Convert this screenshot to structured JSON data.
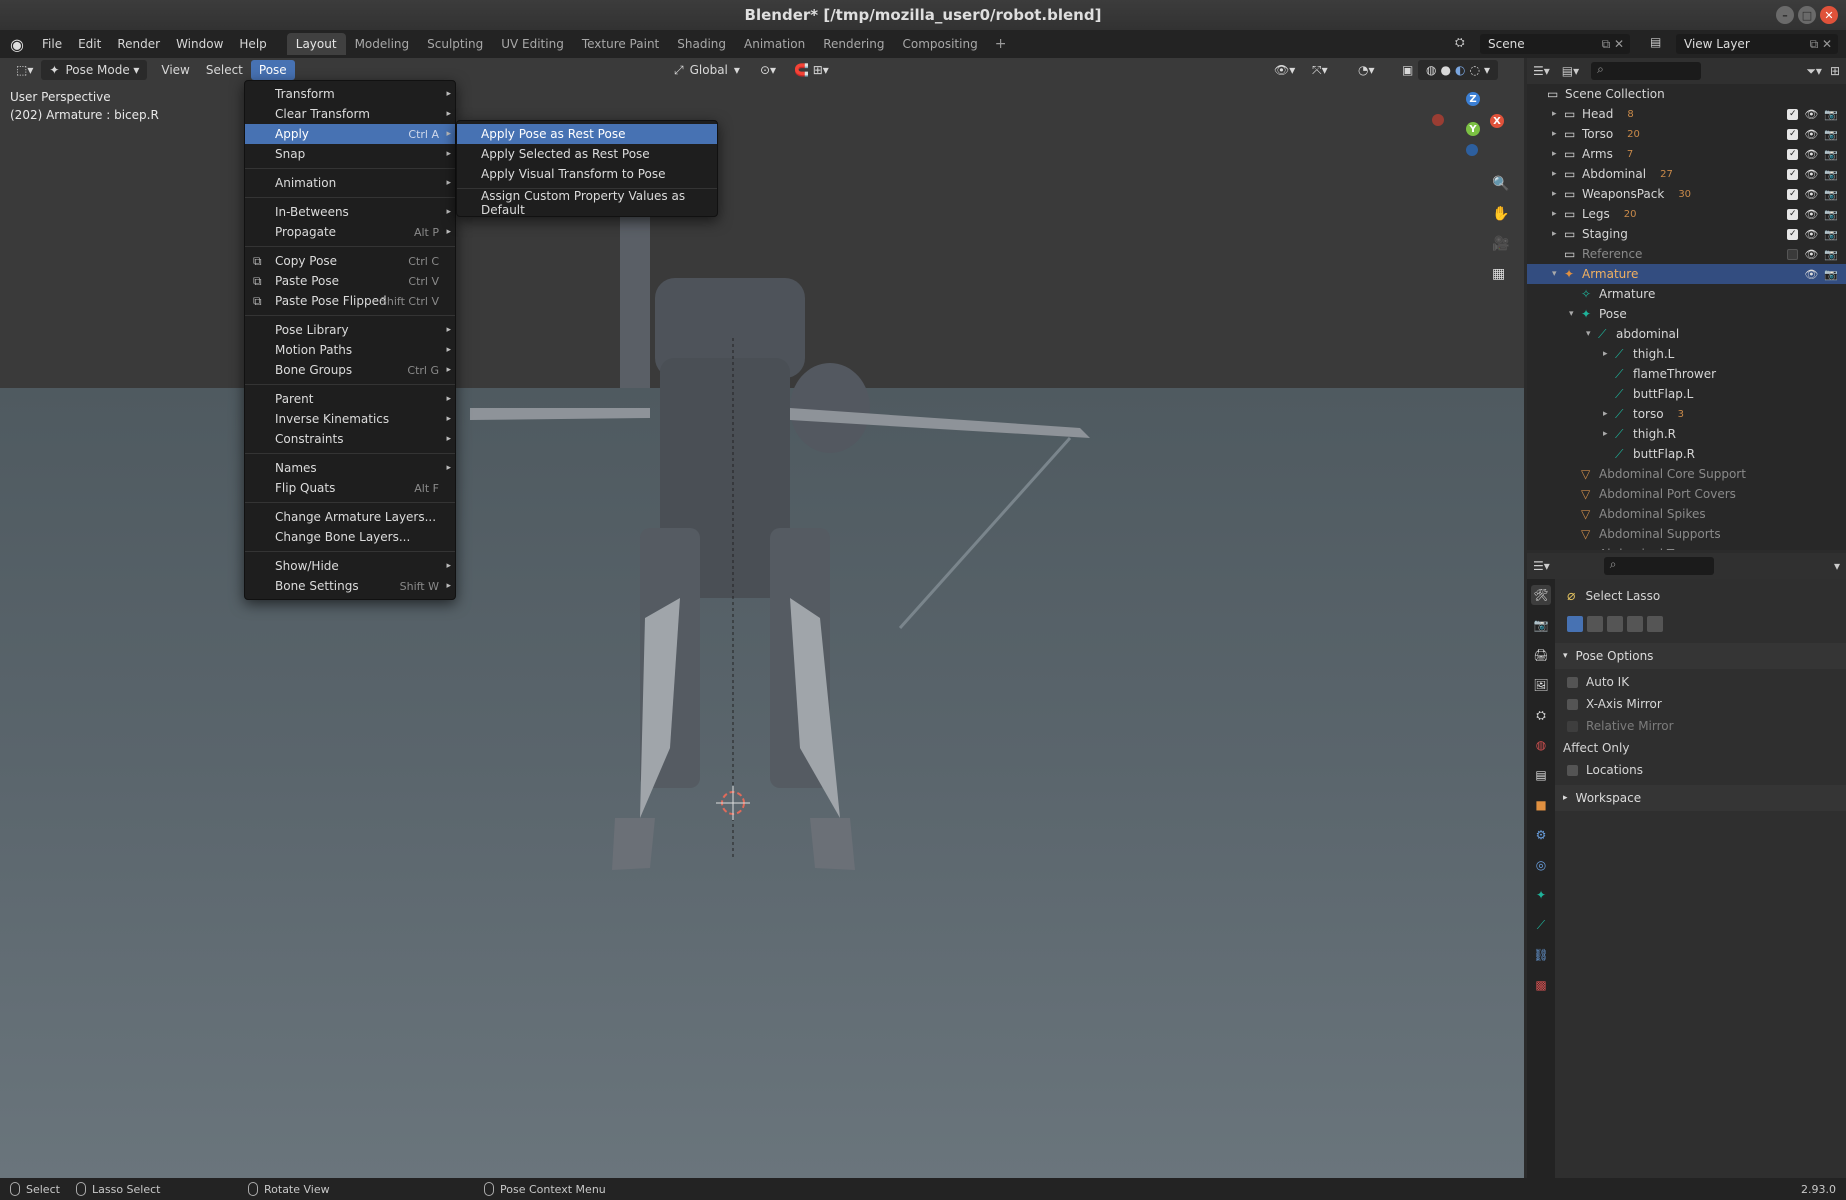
{
  "window": {
    "title": "Blender* [/tmp/mozilla_user0/robot.blend]"
  },
  "topbar": {
    "menus": [
      "File",
      "Edit",
      "Render",
      "Window",
      "Help"
    ],
    "workspaces": [
      "Layout",
      "Modeling",
      "Sculpting",
      "UV Editing",
      "Texture Paint",
      "Shading",
      "Animation",
      "Rendering",
      "Compositing"
    ],
    "active_workspace": "Layout",
    "add_tab": "+",
    "scene": "Scene",
    "view_layer": "View Layer"
  },
  "viewport": {
    "mode": "Pose Mode",
    "menus": [
      "View",
      "Select",
      "Pose"
    ],
    "orientation": "Global",
    "perspective_label": "User Perspective",
    "active_info": "(202) Armature : bicep.R",
    "gizmo": {
      "x": "X",
      "y": "Y",
      "z": "Z"
    }
  },
  "pose_menu": {
    "items": [
      {
        "label": "Transform",
        "shortcut": "",
        "submenu": true
      },
      {
        "label": "Clear Transform",
        "shortcut": "",
        "submenu": true
      },
      {
        "label": "Apply",
        "shortcut": "Ctrl A",
        "submenu": true,
        "highlighted": true
      },
      {
        "label": "Snap",
        "shortcut": "",
        "submenu": true
      },
      {
        "sep": true
      },
      {
        "label": "Animation",
        "shortcut": "",
        "submenu": true
      },
      {
        "sep": true
      },
      {
        "label": "In-Betweens",
        "shortcut": "",
        "submenu": true
      },
      {
        "label": "Propagate",
        "shortcut": "Alt P",
        "submenu": true
      },
      {
        "sep": true
      },
      {
        "label": "Copy Pose",
        "shortcut": "Ctrl C",
        "icon": "copy-icon"
      },
      {
        "label": "Paste Pose",
        "shortcut": "Ctrl V",
        "icon": "paste-icon"
      },
      {
        "label": "Paste Pose Flipped",
        "shortcut": "Shift Ctrl V",
        "icon": "paste-flipped-icon"
      },
      {
        "sep": true
      },
      {
        "label": "Pose Library",
        "shortcut": "",
        "submenu": true
      },
      {
        "label": "Motion Paths",
        "shortcut": "",
        "submenu": true
      },
      {
        "label": "Bone Groups",
        "shortcut": "Ctrl G",
        "submenu": true
      },
      {
        "sep": true
      },
      {
        "label": "Parent",
        "shortcut": "",
        "submenu": true
      },
      {
        "label": "Inverse Kinematics",
        "shortcut": "",
        "submenu": true
      },
      {
        "label": "Constraints",
        "shortcut": "",
        "submenu": true
      },
      {
        "sep": true
      },
      {
        "label": "Names",
        "shortcut": "",
        "submenu": true
      },
      {
        "label": "Flip Quats",
        "shortcut": "Alt F"
      },
      {
        "sep": true
      },
      {
        "label": "Change Armature Layers...",
        "shortcut": ""
      },
      {
        "label": "Change Bone Layers...",
        "shortcut": ""
      },
      {
        "sep": true
      },
      {
        "label": "Show/Hide",
        "shortcut": "",
        "submenu": true
      },
      {
        "label": "Bone Settings",
        "shortcut": "Shift W",
        "submenu": true
      }
    ]
  },
  "apply_submenu": {
    "items": [
      {
        "label": "Apply Pose as Rest Pose",
        "highlighted": true
      },
      {
        "label": "Apply Selected as Rest Pose"
      },
      {
        "label": "Apply Visual Transform to Pose"
      },
      {
        "sep": true
      },
      {
        "label": "Assign Custom Property Values as Default"
      }
    ]
  },
  "outliner": {
    "rows": [
      {
        "label": "Scene Collection",
        "depth": 0,
        "icon": "collection-icon",
        "tri": "",
        "vis": false
      },
      {
        "label": "Head",
        "depth": 1,
        "icon": "collection-icon",
        "tri": "▸",
        "vis": true,
        "badge": "8"
      },
      {
        "label": "Torso",
        "depth": 1,
        "icon": "collection-icon",
        "tri": "▸",
        "vis": true,
        "badge": "20"
      },
      {
        "label": "Arms",
        "depth": 1,
        "icon": "collection-icon",
        "tri": "▸",
        "vis": true,
        "badge": "7"
      },
      {
        "label": "Abdominal",
        "depth": 1,
        "icon": "collection-icon",
        "tri": "▸",
        "vis": true,
        "badge": "27"
      },
      {
        "label": "WeaponsPack",
        "depth": 1,
        "icon": "collection-icon",
        "tri": "▸",
        "vis": true,
        "badge": "30"
      },
      {
        "label": "Legs",
        "depth": 1,
        "icon": "collection-icon",
        "tri": "▸",
        "vis": true,
        "badge": "20"
      },
      {
        "label": "Staging",
        "depth": 1,
        "icon": "collection-icon",
        "tri": "▸",
        "vis": true
      },
      {
        "label": "Reference",
        "depth": 1,
        "icon": "collection-icon",
        "tri": "",
        "vis": true,
        "dim": true,
        "unchecked": true
      },
      {
        "label": "Armature",
        "depth": 1,
        "icon": "armature-icon",
        "tri": "▾",
        "vis": true,
        "selected": true
      },
      {
        "label": "Armature",
        "depth": 2,
        "icon": "armature-data-icon",
        "tri": "",
        "vis": false
      },
      {
        "label": "Pose",
        "depth": 2,
        "icon": "pose-icon",
        "tri": "▾",
        "vis": false
      },
      {
        "label": "abdominal",
        "depth": 3,
        "icon": "bone-icon",
        "tri": "▾",
        "vis": false
      },
      {
        "label": "thigh.L",
        "depth": 4,
        "icon": "bone-icon",
        "tri": "▸",
        "vis": false
      },
      {
        "label": "flameThrower",
        "depth": 4,
        "icon": "bone-icon",
        "tri": "",
        "vis": false
      },
      {
        "label": "buttFlap.L",
        "depth": 4,
        "icon": "bone-icon",
        "tri": "",
        "vis": false
      },
      {
        "label": "torso",
        "depth": 4,
        "icon": "bone-icon",
        "tri": "▸",
        "vis": false,
        "badge": "3"
      },
      {
        "label": "thigh.R",
        "depth": 4,
        "icon": "bone-icon",
        "tri": "▸",
        "vis": false
      },
      {
        "label": "buttFlap.R",
        "depth": 4,
        "icon": "bone-icon",
        "tri": "",
        "vis": false
      },
      {
        "label": "Abdominal Core Support",
        "depth": 2,
        "icon": "mesh-icon",
        "tri": "",
        "vis": false,
        "dim": true
      },
      {
        "label": "Abdominal Port Covers",
        "depth": 2,
        "icon": "mesh-icon",
        "tri": "",
        "vis": false,
        "dim": true
      },
      {
        "label": "Abdominal Spikes",
        "depth": 2,
        "icon": "mesh-icon",
        "tri": "",
        "vis": false,
        "dim": true
      },
      {
        "label": "Abdominal Supports",
        "depth": 2,
        "icon": "mesh-icon",
        "tri": "",
        "vis": false,
        "dim": true
      },
      {
        "label": "Abdominal Tears",
        "depth": 2,
        "icon": "mesh-icon",
        "tri": "",
        "vis": false,
        "dim": true
      }
    ]
  },
  "properties": {
    "tool_name": "Select Lasso",
    "pose_options_title": "Pose Options",
    "auto_ik": "Auto IK",
    "x_axis_mirror": "X-Axis Mirror",
    "relative_mirror": "Relative Mirror",
    "affect_only": "Affect Only",
    "locations": "Locations",
    "workspace_title": "Workspace"
  },
  "statusbar": {
    "select": "Select",
    "lasso_select": "Lasso Select",
    "rotate_view": "Rotate View",
    "pose_context_menu": "Pose Context Menu",
    "version": "2.93.0"
  },
  "colors": {
    "accent": "#4772b3",
    "bone": "#1fb39a",
    "mesh": "#c98a4a",
    "axis_x": "#e0523a",
    "axis_y": "#7bc043",
    "axis_z": "#3b7fd4"
  }
}
